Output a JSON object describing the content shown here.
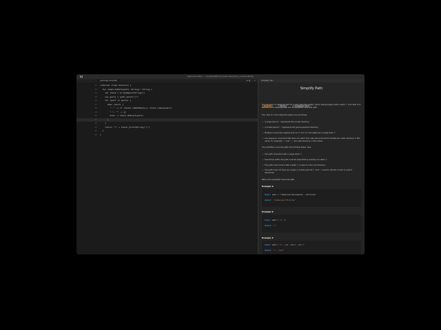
{
  "window": {
    "title": "leetcode-kotlin — SimplifyPath.kt (leetcode-kotlin_summer2024)"
  },
  "editor": {
    "tab_label": "package simplify",
    "controls": "⊞ ◧ ··· ✕",
    "lines": [
      {
        "num": "12",
        "code": "internal class Solution {"
      },
      {
        "num": "13",
        "code": "  fun simplifyPath(path: String): String {"
      },
      {
        "num": "14",
        "code": "    val stack = ArrayDeque<String>()"
      },
      {
        "num": "15",
        "code": "    val parts = path.split(\"/\")"
      },
      {
        "num": "16",
        "code": "    for (part in parts) {"
      },
      {
        "num": "17",
        "code": "      when (part) {"
      },
      {
        "num": "18",
        "code": "        \"..\" -> if (stack.isNotEmpty()) stack.removeLast()"
      },
      {
        "num": "19",
        "code": "        \".\", \"\" -> {}"
      },
      {
        "num": "20",
        "code": "        else -> stack.addLast(part)"
      },
      {
        "num": "21",
        "code": "      }"
      },
      {
        "num": "22",
        "code": "    }"
      },
      {
        "num": "23",
        "code": "    return \"/\" + stack.joinToString(\"/\")"
      },
      {
        "num": "24",
        "code": "  }"
      },
      {
        "num": "25",
        "code": "}"
      }
    ]
  },
  "panel": {
    "tab_label": "Simplify Pa...",
    "title": "Simplify Path",
    "badges": [
      "Medium",
      "Topics",
      "Companies  Hint"
    ],
    "intro": "You are given an absolute path for a Unix-style file system, which always begins with a slash '/'. Your task is to transform this absolute path into its simplified canonical path.",
    "rules_intro": "The rules of a Unix-style file system are as follows:",
    "rules": [
      "A single period '.' represents the current directory.",
      "A double period '..' represents the previous/parent directory.",
      "Multiple consecutive slashes such as '//' and '///' are treated as a single slash '/'.",
      "Any sequence of periods that does not match the rules above should be treated as a valid directory or file name. For example, '...' and '....' are valid directory or file names."
    ],
    "canon_intro": "The simplified canonical path should follow these rules:",
    "canon_rules": [
      "The path must start with a single slash '/'.",
      "Directories within the path must be separated by exactly one slash '/'.",
      "The path must not end with a slash '/', unless it is the root directory.",
      "The path must not have any single or double periods ('.' and '..') used to denote current or parent directories."
    ],
    "return_text": "Return the simplified canonical path.",
    "examples": [
      {
        "heading": "Example 1:",
        "input_label": "Input:",
        "input": "path = \"/home/user/Documents/../Pictures\"",
        "output_label": "Output:",
        "output": "\"/home/user/Pictures\""
      },
      {
        "heading": "Example 2:",
        "input_label": "Input:",
        "input": "path = \"/../\"",
        "output_label": "Output:",
        "output": "\"/\""
      },
      {
        "heading": "Example 3:",
        "input_label": "Input:",
        "input": "path = \"/.../a/../b/c/../d/./\"",
        "output_label": "Output:",
        "output": "\"/.../b/d\""
      }
    ]
  }
}
